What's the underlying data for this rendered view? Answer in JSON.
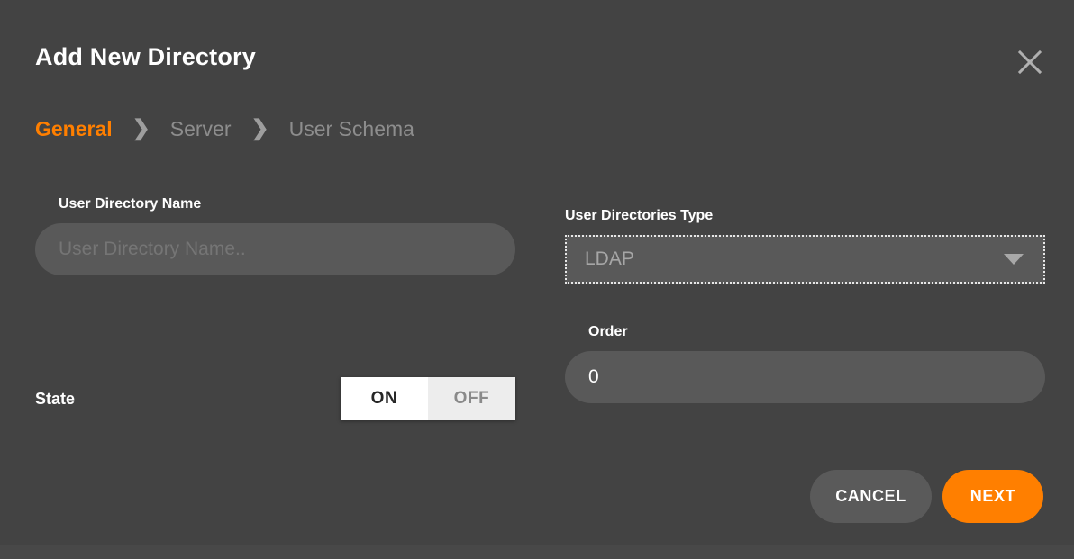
{
  "dialog": {
    "title": "Add New Directory",
    "close_icon": "close-icon"
  },
  "breadcrumb": {
    "separator": "❯",
    "steps": [
      {
        "label": "General",
        "state": "active"
      },
      {
        "label": "Server",
        "state": "inactive"
      },
      {
        "label": "User Schema",
        "state": "inactive"
      }
    ]
  },
  "form": {
    "directory_name": {
      "label": "User Directory Name",
      "value": "",
      "placeholder": "User Directory Name.."
    },
    "directories_type": {
      "label": "User Directories Type",
      "value": "LDAP",
      "options": [
        "LDAP"
      ],
      "arrow_icon": "chevron-down-icon"
    },
    "order": {
      "label": "Order",
      "value": "0",
      "placeholder": "0"
    },
    "state": {
      "label": "State",
      "on_label": "ON",
      "off_label": "OFF",
      "selected": "ON"
    }
  },
  "footer": {
    "cancel_label": "CANCEL",
    "next_label": "NEXT"
  },
  "colors": {
    "accent": "#ff7f00",
    "dialog_bg": "#434343",
    "input_bg": "#595959",
    "text_primary": "#ffffff",
    "text_muted": "#a6a6a6",
    "breadcrumb_inactive": "#8d8d8d"
  }
}
